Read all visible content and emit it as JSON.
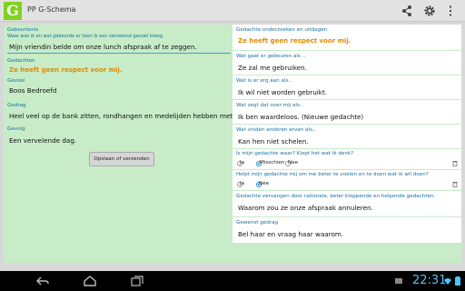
{
  "app": {
    "title": "PP G-Schema",
    "logo_letter": "G"
  },
  "actionbar": {
    "icons": [
      "share-icon",
      "settings-icon",
      "overflow-menu-icon"
    ]
  },
  "left": {
    "gebeurtenis": {
      "label": "Gebeurtenis",
      "sublabel": "Waar was ik en wat gebeurde er toen ik een vervelend gevoel kreeg",
      "value": "Mijn vriendin belde om onze lunch afspraak af te zeggen."
    },
    "gedachten": {
      "label": "Gedachten",
      "value": "Ze heeft geen respect voor mij."
    },
    "gevoel": {
      "label": "Gevoel",
      "value": "Boos Bedroefd"
    },
    "gedrag": {
      "label": "Gedrag",
      "value": "Heel veel op de bank zitten, rondhangen en medelijden hebben met mezelf."
    },
    "gevolg": {
      "label": "Gevolg",
      "value": "Een vervelende dag."
    },
    "save_button": "Opslaan of verzenden"
  },
  "right": {
    "onderzoeken": {
      "label": "Gedachte onderzoeken en uitdagen",
      "value": "Ze heeft geen respect voor mij."
    },
    "q1": {
      "label": "Wat gaat er gebeuren als ..",
      "value": "Ze zal me gebruiken."
    },
    "q2": {
      "label": "Wat is er erg aan als..",
      "value": "Ik wil niet worden gebruikt."
    },
    "q3": {
      "label": "Wat zegt dat over mij als..",
      "value": "Ik ben waardeloos. (Nieuwe gedachte)"
    },
    "q4": {
      "label": "Wat vinden anderen ervan als..",
      "value": "Kan hen niet schelen."
    },
    "check1": {
      "label": "Is mijn gedachte waar? Klopt het wat ik denk?",
      "options": [
        "Ja",
        "Misschien",
        "Nee"
      ],
      "selected": "Misschien"
    },
    "check2": {
      "label": "Helpt mijn gedachte mij om me beter te voelen en te doen wat ik wil doen?",
      "options": [
        "Ja",
        "Nee"
      ],
      "selected": "Nee"
    },
    "vervangen": {
      "label": "Gedachte vervangen door rationele, beter kloppende en helpende gedachten.",
      "value": "Waarom zou ze onze afspraak annuleren."
    },
    "gewenst": {
      "label": "Gewenst gedrag",
      "value": "Bel haar en vraag haar waarom."
    }
  },
  "navbar": {
    "time": "22:31",
    "icons": [
      "back-icon",
      "home-icon",
      "recent-apps-icon"
    ]
  }
}
